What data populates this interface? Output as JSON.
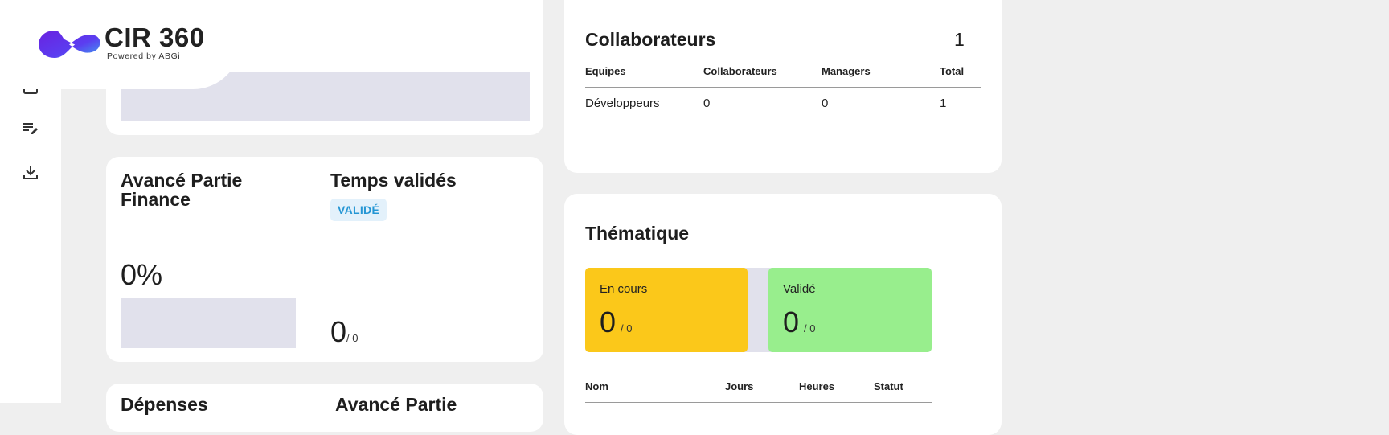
{
  "brand": {
    "name": "CIR 360",
    "tagline": "Powered by ABGi"
  },
  "sidebar": {
    "icons": [
      "calendar-icon",
      "edit-list-icon",
      "download-icon"
    ]
  },
  "finance": {
    "title": "Avancé Partie Finance",
    "value": "0%"
  },
  "temps": {
    "title": "Temps validés",
    "badge": "VALIDÉ",
    "value": "0",
    "total": "/ 0"
  },
  "bottom_cards": {
    "left_title": "Dépenses",
    "right_title": "Avancé Partie"
  },
  "collaborateurs": {
    "title": "Collaborateurs",
    "count": "1",
    "table": {
      "headers": [
        "Equipes",
        "Collaborateurs",
        "Managers",
        "Total"
      ],
      "rows": [
        [
          "Développeurs",
          "0",
          "0",
          "1"
        ]
      ]
    }
  },
  "thematique": {
    "title": "Thématique",
    "stats": [
      {
        "label": "En cours",
        "value": "0",
        "total": "/ 0",
        "color": "#fbc81a"
      },
      {
        "label": "Validé",
        "value": "0",
        "total": "/ 0",
        "color": "#98ee8d"
      }
    ],
    "table": {
      "headers": [
        "Nom",
        "Jours",
        "Heures",
        "Statut"
      ]
    }
  },
  "colors": {
    "background": "#efefef",
    "card": "#ffffff",
    "bar_placeholder": "#e1e1ec",
    "badge_text": "#2596d4"
  }
}
